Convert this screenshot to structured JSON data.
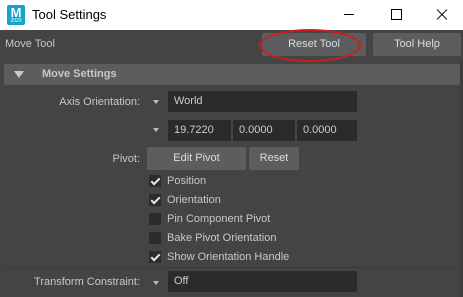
{
  "window": {
    "title": "Tool Settings",
    "app_icon_letter": "M",
    "app_icon_sub": "2020"
  },
  "toolbar": {
    "tool_name": "Move Tool",
    "reset_tool_label": "Reset Tool",
    "tool_help_label": "Tool Help"
  },
  "section": {
    "title": "Move Settings"
  },
  "axis_orientation": {
    "label": "Axis Orientation:",
    "value": "World",
    "custom_values": [
      "19.7220",
      "0.0000",
      "0.0000"
    ]
  },
  "pivot": {
    "label": "Pivot:",
    "edit_pivot_label": "Edit Pivot",
    "reset_label": "Reset",
    "options": [
      {
        "label": "Position",
        "checked": true
      },
      {
        "label": "Orientation",
        "checked": true
      },
      {
        "label": "Pin Component Pivot",
        "checked": false
      },
      {
        "label": "Bake Pivot Orientation",
        "checked": false
      },
      {
        "label": "Show Orientation Handle",
        "checked": true
      }
    ]
  },
  "transform_constraint": {
    "label": "Transform Constraint:",
    "value": "Off"
  },
  "colors": {
    "accent_highlight": "#cc1d1d",
    "app_icon": "#17a2c8",
    "panel_bg": "#444444",
    "field_bg": "#2b2b2b"
  }
}
